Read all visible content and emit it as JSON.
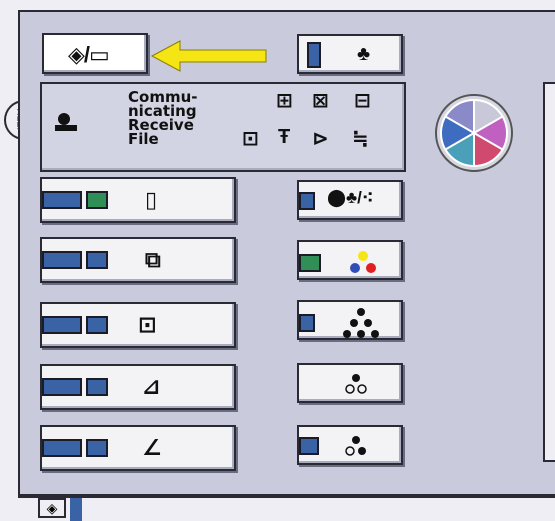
{
  "mode_button": {
    "icon": "copy-fax-mode-icon",
    "glyph": "◈/▭"
  },
  "arrow": {
    "icon": "yellow-arrow-icon",
    "color": "#f5e514"
  },
  "top_right_button": {
    "icon": "user-tools-icon",
    "glyph": "♣"
  },
  "communicating": {
    "label_lines": [
      "Commu-",
      "nicating",
      "Receive",
      "File"
    ],
    "icons": [
      "receive-file-icon",
      "fax-icon",
      "tray-icon",
      "memory-icon",
      "wrench-icon",
      "document-arrow-icon",
      "settings-icon",
      "printer-icon"
    ]
  },
  "left_rows": [
    {
      "icon": "paper-tray-icon",
      "glyph": "▯",
      "gauge": [
        "blue",
        "green"
      ]
    },
    {
      "icon": "duplex-icon",
      "glyph": "⧉",
      "gauge": [
        "blue",
        "blue"
      ]
    },
    {
      "icon": "booklet-icon",
      "glyph": "⊡",
      "gauge": [
        "blue",
        "blue"
      ]
    },
    {
      "icon": "output-tray-icon",
      "glyph": "⊿",
      "gauge": [
        "blue",
        "blue"
      ]
    },
    {
      "icon": "staple-icon",
      "glyph": "∠",
      "gauge": [
        "blue",
        "blue"
      ]
    }
  ],
  "right_rows": [
    {
      "icon": "toner-all-icon",
      "glyph": "⬤♣/⁖",
      "gauge": "blue"
    },
    {
      "icon": "toner-color-icon",
      "glyph": "⁖",
      "gauge": "green"
    },
    {
      "icon": "toner-black-icon",
      "glyph": "⁖",
      "gauge": "blue"
    },
    {
      "icon": "toner-empty-icon",
      "glyph": "⁖",
      "gauge": "none"
    },
    {
      "icon": "toner-low-icon",
      "glyph": "⁖",
      "gauge": "blue"
    }
  ],
  "color_wheel": {
    "icon": "color-wheel-icon"
  },
  "bottom": {
    "icon": "mode-switch-icon",
    "glyph": "◈"
  },
  "colors": {
    "blue": "#3a63a6",
    "green": "#2f8f57",
    "yellow": "#f5e514",
    "red": "#e02020"
  }
}
